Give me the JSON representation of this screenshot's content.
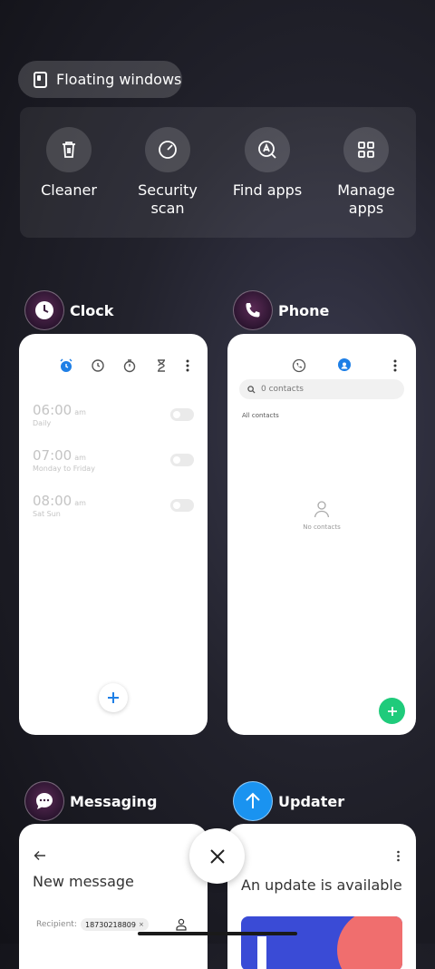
{
  "floating_windows": {
    "label": "Floating windows"
  },
  "tools": [
    {
      "label": "Cleaner",
      "icon": "trash-icon"
    },
    {
      "label": "Security scan",
      "icon": "shield-scan-icon"
    },
    {
      "label": "Find apps",
      "icon": "find-apps-icon"
    },
    {
      "label": "Manage apps",
      "icon": "grid-icon"
    }
  ],
  "apps": {
    "clock": {
      "name": "Clock",
      "alarms": [
        {
          "time": "06:00",
          "ampm": "am",
          "repeat": "Daily"
        },
        {
          "time": "07:00",
          "ampm": "am",
          "repeat": "Monday to Friday"
        },
        {
          "time": "08:00",
          "ampm": "am",
          "repeat": "Sat Sun"
        }
      ]
    },
    "phone": {
      "name": "Phone",
      "search_placeholder": "0 contacts",
      "section_label": "All contacts",
      "empty_text": "No contacts"
    },
    "messaging": {
      "name": "Messaging",
      "title": "New message",
      "recipient_label": "Recipient:",
      "recipient_chip": "18730218809"
    },
    "updater": {
      "name": "Updater",
      "title": "An update is available"
    }
  },
  "colors": {
    "accent_blue": "#1e7fe6",
    "phone_green": "#1fcb7b",
    "updater_blue": "#1a93f0"
  }
}
